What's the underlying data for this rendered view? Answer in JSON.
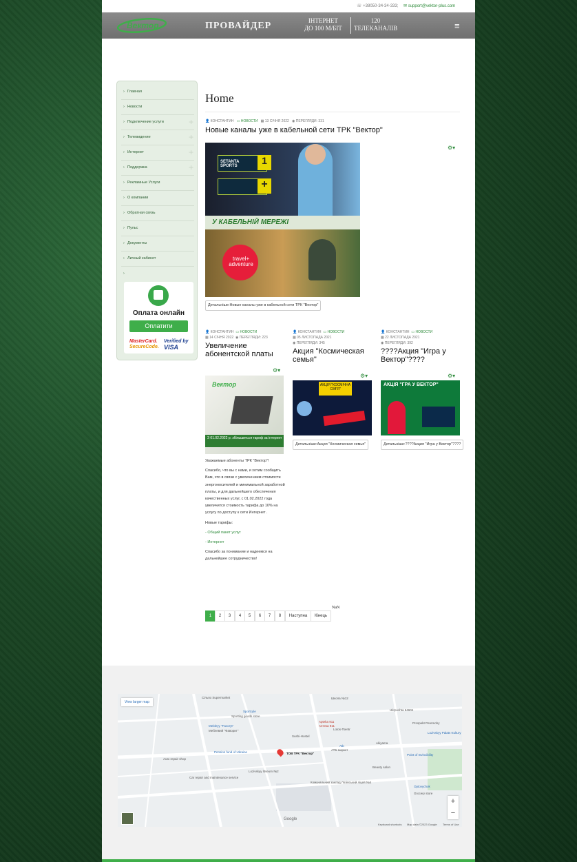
{
  "topbar": {
    "phone": "+38050-34-34-333;",
    "email": "support@vektor-plus.com"
  },
  "header": {
    "logo_text": "Вектор",
    "provider": "ПРОВАЙДЕР",
    "internet_line1": "ІНТЕРНЕТ",
    "internet_line2": "ДО 100 М/БІТ",
    "tv_line1": "120",
    "tv_line2": "ТЕЛЕКАНАЛІВ",
    "menu_icon": "hamburger-icon"
  },
  "sidebar": {
    "items": [
      {
        "label": "Главная",
        "expandable": false
      },
      {
        "label": "Новости",
        "expandable": false
      },
      {
        "label": "Подключение услуги",
        "expandable": true
      },
      {
        "label": "Телевидение",
        "expandable": true
      },
      {
        "label": "Интернет",
        "expandable": true
      },
      {
        "label": "Поддержка",
        "expandable": true
      },
      {
        "label": "Рекламные Услуги",
        "expandable": false
      },
      {
        "label": "О компании",
        "expandable": false
      },
      {
        "label": "Обратная связь",
        "expandable": false
      },
      {
        "label": "Пульс",
        "expandable": false
      },
      {
        "label": "Документы",
        "expandable": false
      },
      {
        "label": "Личный кабинет",
        "expandable": false
      },
      {
        "label": "",
        "expandable": false
      }
    ],
    "payment": {
      "title": "Оплата онлайн",
      "button": "Оплатити",
      "mc1": "MasterCard.",
      "mc2": "SecureCode.",
      "visa1": "Verified by",
      "visa2": "VISA"
    }
  },
  "main": {
    "title": "Home",
    "featured": {
      "author": "КОНСТАНТИН",
      "category": "НОВОСТИ",
      "date": "13 СІЧНЯ 2022",
      "views": "ПЕРЕГЛЯДИ: 331",
      "title": "Новые каналы уже в кабельной сети ТРК \"Вектор\"",
      "image_text1": "SETANTA SPORTS",
      "image_text2": "У КАБЕЛЬНІЙ МЕРЕЖІ",
      "image_text3": "travel+ adventure",
      "more": "Детальніше:Новые каналы уже в кабельной сети ТРК \"Вектор\""
    },
    "articles": [
      {
        "author": "КОНСТАНТИН",
        "category": "НОВОСТИ",
        "date": "14 СІЧНЯ 2022",
        "views": "ПЕРЕГЛЯДИ: 223",
        "title": "Увеличение абонентской платы",
        "image_text": "З 01.02.2022 р. збільшиться тариф за інтернет"
      },
      {
        "author": "КОНСТАНТИН",
        "category": "НОВОСТИ",
        "date": "05 ЛИСТОПАДА 2021",
        "views": "ПЕРЕГЛЯДИ: 345",
        "title": "Акция \"Космическая семья\"",
        "image_text": "АКЦІЯ \"КОСМІЧНА СІМ'Я\"",
        "more": "Детальніше:Акция \"Космическая семья\""
      },
      {
        "author": "КОНСТАНТИН",
        "category": "НОВОСТИ",
        "date": "22 ЛИСТОПАДА 2021",
        "views": "ПЕРЕГЛЯДИ: 392",
        "title": "????Акция \"Игра у Вектор\"????",
        "image_text": "АКЦІЯ \"ГРА У ВЕКТОР\"",
        "more": "Детальніше:????Акция \"Игра у Вектор\"????"
      }
    ],
    "body": {
      "p1": "Уважаемые абоненты ТРК \"Вектор\"!",
      "p2": "Спасибо, что вы с нами, и хотим сообщить Вам, что в связи с увеличением стоимости энергоносителей и минимальной заработной платы, и для дальнейшего обеспечения качественных услуг, с 01.02.2022 года увеличится стоимость тарифа до 10% на услугу по доступу к сети Интернет .",
      "p3": "Новые тарифы:",
      "p4": "- Общий пакет услуг",
      "p5": "- Интернет",
      "p6": "Спасибо за понимание и надеемся на дальнейшее сотрудничество!"
    },
    "pagination": {
      "pages": [
        "1",
        "2",
        "3",
        "4",
        "5",
        "6",
        "7",
        "8"
      ],
      "next": "Наступна",
      "last": "Кінець",
      "current": "1",
      "nan": "NaN"
    }
  },
  "map": {
    "view_larger": "View larger map",
    "labels": [
      "Сільпо Supermarket",
      "Ukrposhta 64604",
      "Школа №12",
      "Sportcyle",
      "Sporting goods store",
      "Mebleyy \"Favoryt\"",
      "Меблевий \"Фаворит\"",
      "Lotos-Tsentr",
      "Apteka 911",
      "Аптека 911",
      "Sushi-Hostel",
      "Atb",
      "АТБ-маркет",
      "Akiyama",
      "Pension fund of Ukraine",
      "ТОВ ТРК \"Вектор\"",
      "Point of Invincibility",
      "Lozivskyy Palats Kultury",
      "Auto repair shop",
      "Beauty salon",
      "Lozivskyy litseum №2",
      "Комунальний заклад Лозівський ліцей №4",
      "Optovychok",
      "Grocery store",
      "Car repair and maintenance service",
      "Prospekt Peremohy",
      "Google",
      "Keyboard shortcuts",
      "Map data ©2023 Google",
      "Terms of Use"
    ],
    "zoom_in": "+",
    "zoom_out": "−"
  }
}
